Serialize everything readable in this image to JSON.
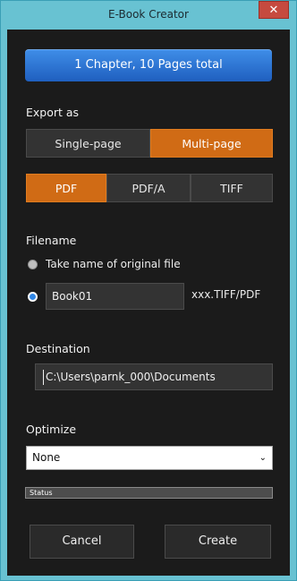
{
  "window": {
    "title": "E-Book Creator",
    "close_glyph": "✕"
  },
  "summary": {
    "label": "1 Chapter, 10 Pages total"
  },
  "export": {
    "label": "Export as",
    "mode": {
      "options": [
        "Single-page",
        "Multi-page"
      ],
      "selected": "Multi-page"
    },
    "format": {
      "options": [
        "PDF",
        "PDF/A",
        "TIFF"
      ],
      "selected": "PDF"
    }
  },
  "filename": {
    "label": "Filename",
    "option_original": "Take name of original file",
    "custom_value": "Book01",
    "suffix": "xxx.TIFF/PDF",
    "selected": "custom"
  },
  "destination": {
    "label": "Destination",
    "path": "C:\\Users\\parnk_000\\Documents"
  },
  "optimize": {
    "label": "Optimize",
    "selected": "None"
  },
  "status": {
    "label": "Status"
  },
  "buttons": {
    "cancel": "Cancel",
    "create": "Create"
  },
  "colors": {
    "accent": "#d06b15",
    "title_bar": "#68c2d2",
    "summary_blue": "#2f78d8"
  }
}
